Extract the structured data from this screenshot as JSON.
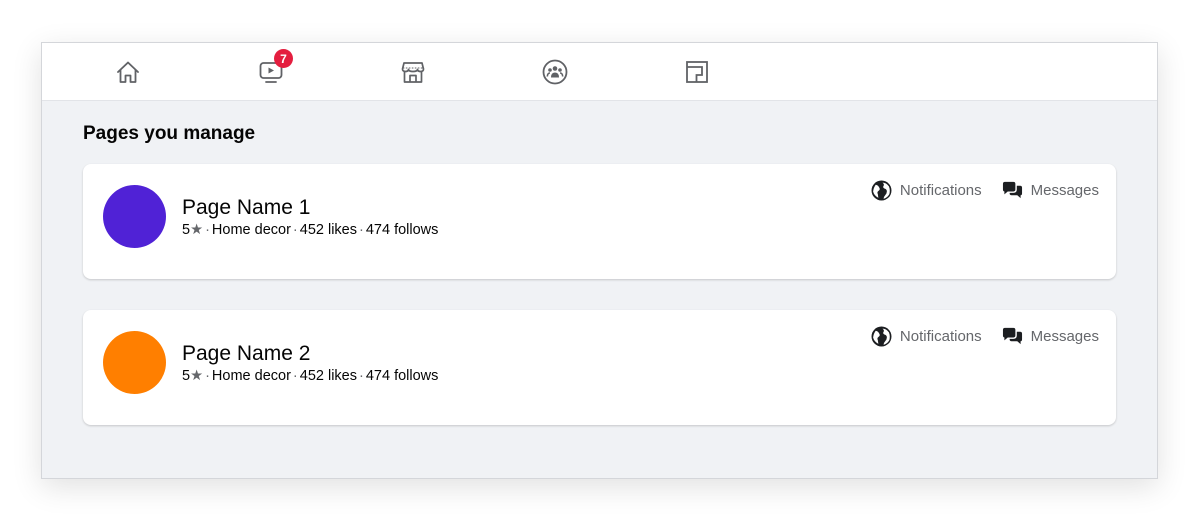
{
  "nav": {
    "items": [
      {
        "name": "home",
        "icon": "home-icon"
      },
      {
        "name": "watch",
        "icon": "video-icon",
        "badge": "7"
      },
      {
        "name": "marketplace",
        "icon": "store-icon"
      },
      {
        "name": "groups",
        "icon": "groups-icon"
      },
      {
        "name": "gaming",
        "icon": "gaming-icon"
      }
    ]
  },
  "main": {
    "title": "Pages you manage",
    "pages": [
      {
        "name": "Page Name 1",
        "avatar_color": "#5022d6",
        "rating": "5",
        "category": "Home decor",
        "likes_count": "452",
        "likes_label": "likes",
        "follows_count": "474",
        "follows_label": "follows",
        "actions": {
          "notifications": "Notifications",
          "messages": "Messages"
        }
      },
      {
        "name": "Page Name 2",
        "avatar_color": "#ff7f00",
        "rating": "5",
        "category": "Home decor",
        "likes_count": "452",
        "likes_label": "likes",
        "follows_count": "474",
        "follows_label": "follows",
        "actions": {
          "notifications": "Notifications",
          "messages": "Messages"
        }
      }
    ]
  },
  "colors": {
    "badge": "#e41e3f",
    "icon_gray": "#606266",
    "background": "#f0f2f5"
  }
}
